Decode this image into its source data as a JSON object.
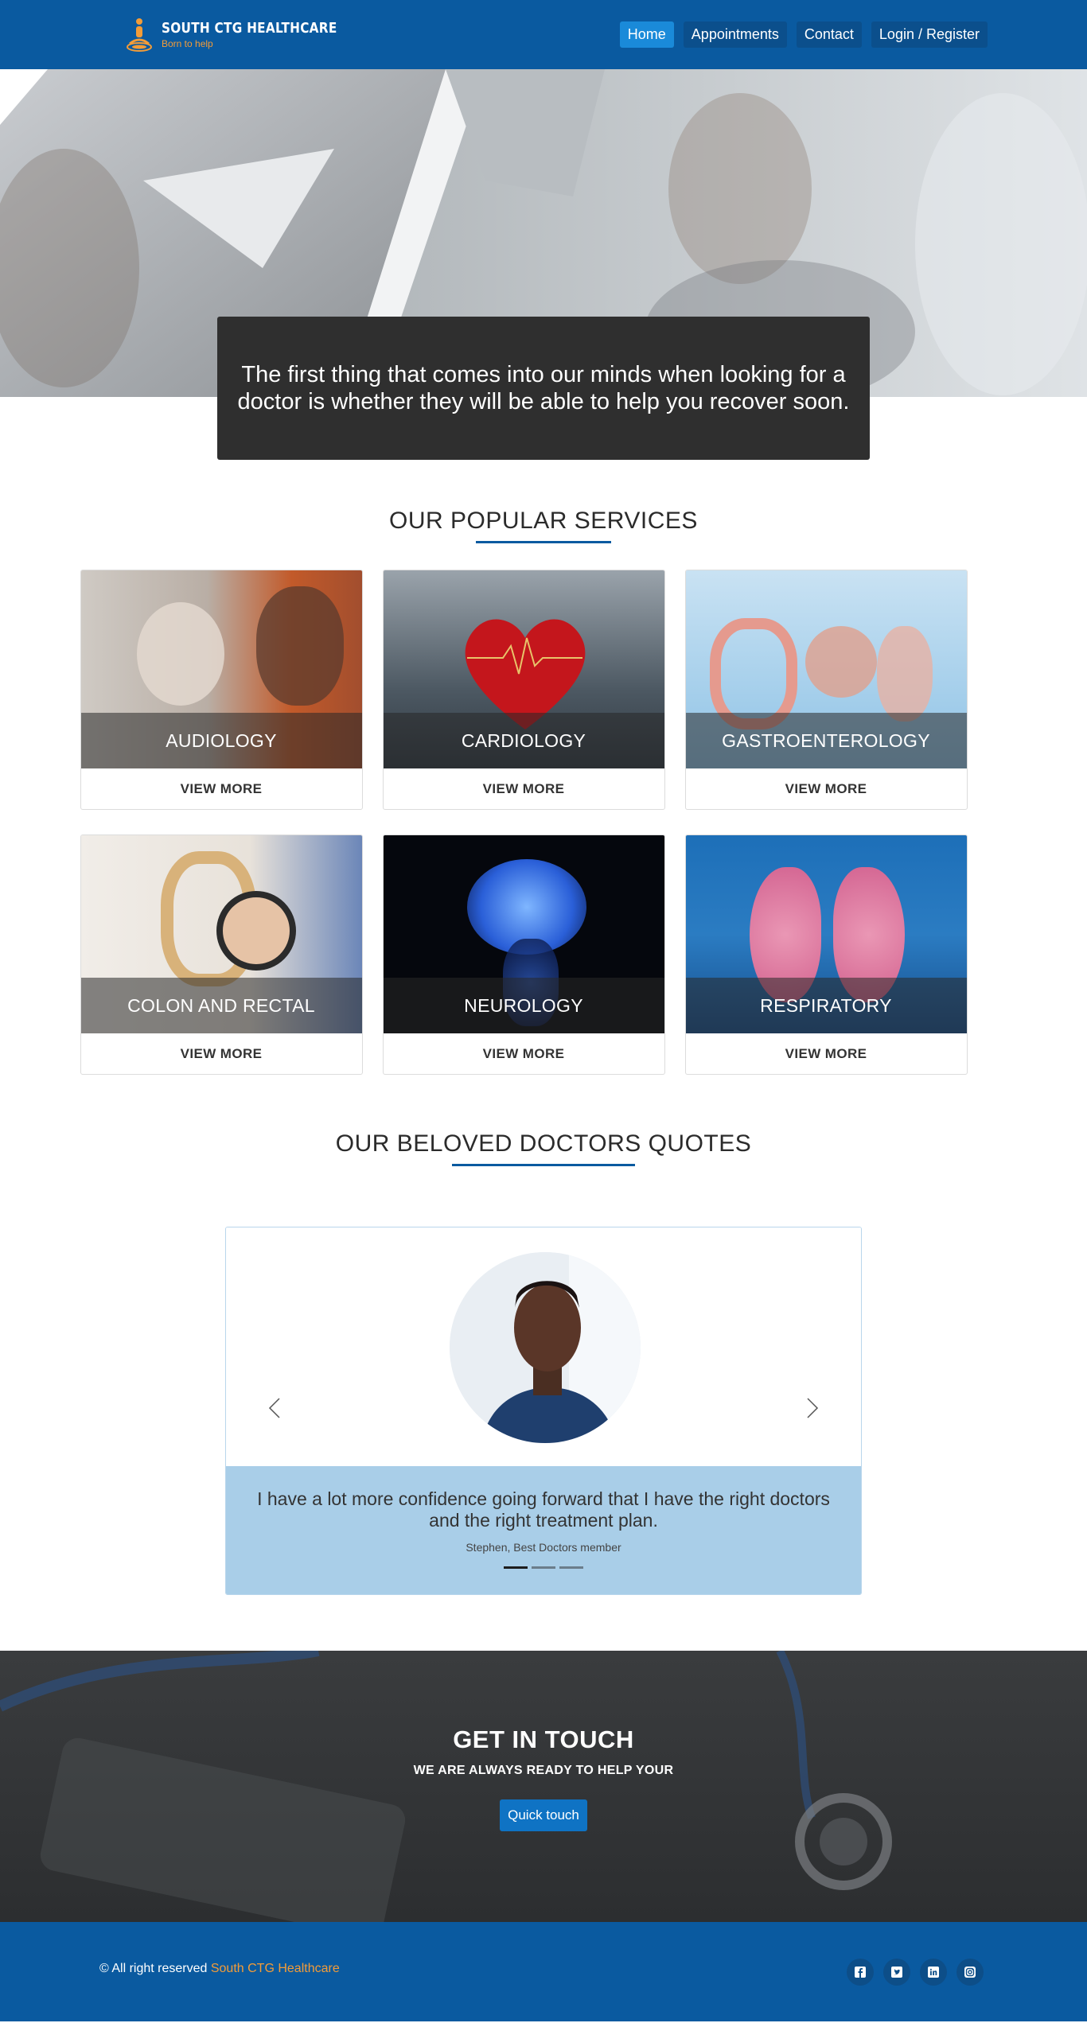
{
  "brand": {
    "name": "SOUTH CTG HEALTHCARE",
    "tagline": "Born to help",
    "logo_icon": "meditation-person-icon"
  },
  "nav": {
    "items": [
      {
        "label": "Home",
        "active": true
      },
      {
        "label": "Appointments"
      },
      {
        "label": "Contact"
      },
      {
        "label": "Login / Register"
      }
    ]
  },
  "hero": {
    "caption": "The first thing that comes into our minds when looking for a doctor is whether they will be able to help you recover soon."
  },
  "services": {
    "title": "OUR POPULAR SERVICES",
    "more_label": "VIEW MORE",
    "items": [
      {
        "name": "AUDIOLOGY"
      },
      {
        "name": "CARDIOLOGY"
      },
      {
        "name": "GASTROENTEROLOGY"
      },
      {
        "name": "COLON AND RECTAL"
      },
      {
        "name": "NEUROLOGY"
      },
      {
        "name": "RESPIRATORY"
      }
    ]
  },
  "quotes": {
    "title": "OUR BELOVED DOCTORS QUOTES",
    "text": "I have a lot more confidence going forward that I have the right doctors and the right treatment plan.",
    "author": "Stephen, Best Doctors member",
    "slides": 3,
    "active_slide": 1
  },
  "contact": {
    "title": "GET IN TOUCH",
    "subtitle": "WE ARE ALWAYS READY TO HELP YOUR",
    "button": "Quick touch"
  },
  "footer": {
    "copyright_prefix": "© All right reserved",
    "copyright_brand": "South CTG Healthcare",
    "socials": [
      "facebook-icon",
      "twitter-icon",
      "linkedin-icon",
      "instagram-icon"
    ]
  },
  "colors": {
    "primary": "#0a5aa0",
    "accent": "#f39c38",
    "quote_bg": "#a9cee8",
    "dark_section": "#2f2f2f"
  }
}
